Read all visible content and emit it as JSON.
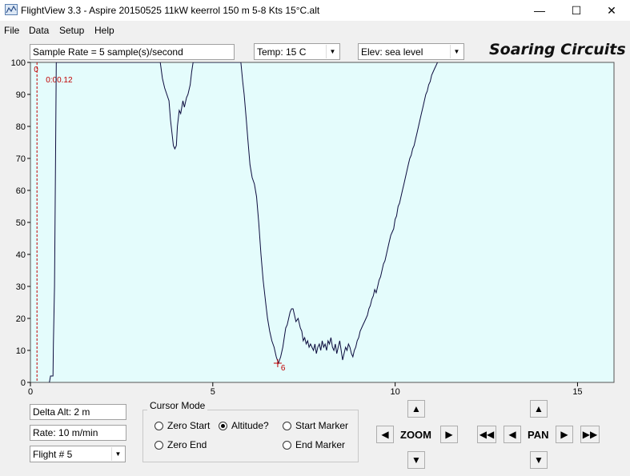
{
  "window": {
    "title": "FlightView 3.3 - Aspire 20150525 11kW keerrol 150 m 5-8 Kts 15°C.alt",
    "minimize": "—",
    "maximize": "☐",
    "close": "✕"
  },
  "menu": [
    "File",
    "Data",
    "Setup",
    "Help"
  ],
  "toolbar": {
    "sample_rate": "Sample Rate =  5 sample(s)/second",
    "temp": "Temp:  15 C",
    "elev": "Elev: sea level",
    "brand": "Soaring Circuits"
  },
  "chart_data": {
    "type": "line",
    "xlim": [
      0,
      16
    ],
    "ylim": [
      0,
      100
    ],
    "x_ticks": [
      "0",
      "5",
      "10",
      "15"
    ],
    "y_ticks": [
      "0",
      "10",
      "20",
      "30",
      "40",
      "50",
      "60",
      "70",
      "80",
      "90",
      "100"
    ],
    "background": "#e4fcfc",
    "line_color": "#0c0c3e",
    "marker_color": "#c00000",
    "markers": [
      {
        "label": "0",
        "x": 0.18
      },
      {
        "label": "0:00.12",
        "x": 0.18
      }
    ],
    "cursor": {
      "label": "6",
      "x": 6.78,
      "y": 6
    },
    "series": [
      {
        "points": [
          [
            0.52,
            0
          ],
          [
            0.55,
            2
          ],
          [
            0.62,
            2
          ],
          [
            0.63,
            12
          ],
          [
            0.66,
            30
          ],
          [
            0.69,
            70
          ],
          [
            0.71,
            100
          ],
          [
            3.56,
            100
          ],
          [
            3.62,
            95
          ],
          [
            3.68,
            92
          ],
          [
            3.74,
            90
          ],
          [
            3.8,
            88
          ],
          [
            3.84,
            82
          ],
          [
            3.88,
            78
          ],
          [
            3.92,
            74
          ],
          [
            3.96,
            73
          ],
          [
            4.0,
            74
          ],
          [
            4.03,
            80
          ],
          [
            4.08,
            85
          ],
          [
            4.12,
            84
          ],
          [
            4.18,
            88
          ],
          [
            4.22,
            86
          ],
          [
            4.28,
            89
          ],
          [
            4.32,
            90
          ],
          [
            4.38,
            93
          ],
          [
            4.42,
            97
          ],
          [
            4.46,
            100
          ],
          [
            5.77,
            100
          ],
          [
            5.82,
            94
          ],
          [
            5.86,
            90
          ],
          [
            5.92,
            82
          ],
          [
            5.96,
            76
          ],
          [
            6.02,
            68
          ],
          [
            6.08,
            64
          ],
          [
            6.14,
            62
          ],
          [
            6.2,
            58
          ],
          [
            6.26,
            50
          ],
          [
            6.32,
            40
          ],
          [
            6.38,
            32
          ],
          [
            6.42,
            28
          ],
          [
            6.46,
            24
          ],
          [
            6.5,
            20
          ],
          [
            6.56,
            16
          ],
          [
            6.62,
            13
          ],
          [
            6.68,
            11
          ],
          [
            6.74,
            8
          ],
          [
            6.8,
            6
          ],
          [
            6.86,
            8
          ],
          [
            6.92,
            11
          ],
          [
            6.96,
            14
          ],
          [
            7.0,
            17
          ],
          [
            7.04,
            18
          ],
          [
            7.08,
            20
          ],
          [
            7.12,
            22
          ],
          [
            7.16,
            23
          ],
          [
            7.2,
            23
          ],
          [
            7.24,
            21
          ],
          [
            7.28,
            19
          ],
          [
            7.34,
            20
          ],
          [
            7.4,
            17
          ],
          [
            7.44,
            16
          ],
          [
            7.48,
            13
          ],
          [
            7.52,
            14
          ],
          [
            7.56,
            12
          ],
          [
            7.6,
            13
          ],
          [
            7.64,
            11
          ],
          [
            7.68,
            12
          ],
          [
            7.72,
            11
          ],
          [
            7.76,
            10
          ],
          [
            7.8,
            12
          ],
          [
            7.84,
            9
          ],
          [
            7.88,
            11
          ],
          [
            7.92,
            12
          ],
          [
            7.96,
            10
          ],
          [
            8.0,
            13
          ],
          [
            8.04,
            11
          ],
          [
            8.08,
            12
          ],
          [
            8.12,
            10
          ],
          [
            8.16,
            13
          ],
          [
            8.2,
            12
          ],
          [
            8.24,
            14
          ],
          [
            8.28,
            11
          ],
          [
            8.32,
            10
          ],
          [
            8.36,
            12
          ],
          [
            8.4,
            9
          ],
          [
            8.44,
            11
          ],
          [
            8.48,
            13
          ],
          [
            8.52,
            10
          ],
          [
            8.56,
            7
          ],
          [
            8.6,
            9
          ],
          [
            8.64,
            11
          ],
          [
            8.68,
            10
          ],
          [
            8.72,
            12
          ],
          [
            8.76,
            11
          ],
          [
            8.8,
            9
          ],
          [
            8.84,
            8
          ],
          [
            8.88,
            10
          ],
          [
            8.92,
            11
          ],
          [
            8.96,
            13
          ],
          [
            9.0,
            14
          ],
          [
            9.04,
            16
          ],
          [
            9.08,
            17
          ],
          [
            9.12,
            18
          ],
          [
            9.16,
            19
          ],
          [
            9.2,
            20
          ],
          [
            9.24,
            21
          ],
          [
            9.28,
            23
          ],
          [
            9.32,
            24
          ],
          [
            9.36,
            26
          ],
          [
            9.4,
            27
          ],
          [
            9.44,
            29
          ],
          [
            9.48,
            28
          ],
          [
            9.52,
            30
          ],
          [
            9.56,
            32
          ],
          [
            9.6,
            33
          ],
          [
            9.64,
            35
          ],
          [
            9.68,
            37
          ],
          [
            9.72,
            38
          ],
          [
            9.76,
            40
          ],
          [
            9.8,
            42
          ],
          [
            9.84,
            44
          ],
          [
            9.88,
            46
          ],
          [
            9.92,
            47
          ],
          [
            9.96,
            48
          ],
          [
            10.0,
            51
          ],
          [
            10.04,
            52
          ],
          [
            10.08,
            55
          ],
          [
            10.12,
            56
          ],
          [
            10.16,
            58
          ],
          [
            10.2,
            60
          ],
          [
            10.24,
            62
          ],
          [
            10.28,
            64
          ],
          [
            10.32,
            66
          ],
          [
            10.36,
            68
          ],
          [
            10.4,
            70
          ],
          [
            10.44,
            71
          ],
          [
            10.48,
            73
          ],
          [
            10.52,
            74
          ],
          [
            10.56,
            76
          ],
          [
            10.6,
            78
          ],
          [
            10.64,
            80
          ],
          [
            10.68,
            82
          ],
          [
            10.72,
            84
          ],
          [
            10.76,
            86
          ],
          [
            10.8,
            88
          ],
          [
            10.84,
            90
          ],
          [
            10.88,
            91
          ],
          [
            10.92,
            93
          ],
          [
            10.96,
            94
          ],
          [
            11.0,
            96
          ],
          [
            11.04,
            97
          ],
          [
            11.08,
            98
          ],
          [
            11.12,
            99
          ],
          [
            11.16,
            100
          ]
        ]
      }
    ]
  },
  "readouts": {
    "delta_alt": "Delta Alt: 2 m",
    "rate": "Rate: 10 m/min",
    "flight": "Flight # 5"
  },
  "cursor_mode": {
    "title": "Cursor Mode",
    "options": [
      {
        "label": "Zero Start",
        "selected": false
      },
      {
        "label": "Altitude?",
        "selected": true
      },
      {
        "label": "Start Marker",
        "selected": false
      },
      {
        "label": "Zero End",
        "selected": false
      },
      {
        "label": "End Marker",
        "selected": false
      }
    ]
  },
  "nav": {
    "zoom_label": "ZOOM",
    "pan_label": "PAN"
  }
}
